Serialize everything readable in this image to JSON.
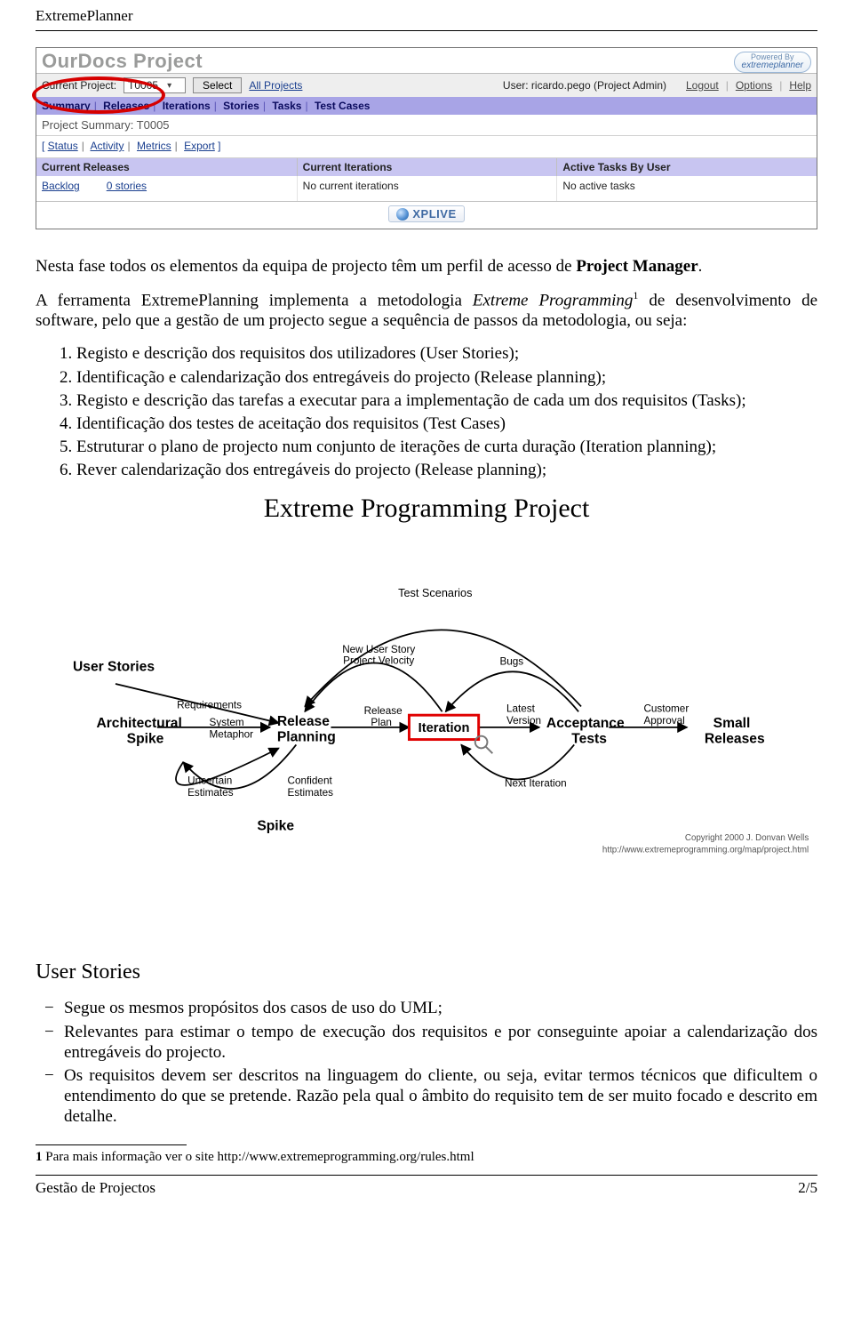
{
  "header": "ExtremePlanner",
  "app": {
    "title": "OurDocs Project",
    "powered_l1": "Powered By",
    "powered_l2": "extremeplanner",
    "current_project_lbl": "Current Project:",
    "current_project_val": "T0005",
    "select_btn": "Select",
    "all_projects": "All Projects",
    "user_lbl": "User: ricardo.pego (Project Admin)",
    "logout": "Logout",
    "options": "Options",
    "help": "Help",
    "tabs": [
      "Summary",
      "Releases",
      "Iterations",
      "Stories",
      "Tasks",
      "Test Cases"
    ],
    "psum": "Project Summary: T0005",
    "subtabs": [
      "Status",
      "Activity",
      "Metrics",
      "Export"
    ],
    "col1_h": "Current Releases",
    "col1_a": "Backlog",
    "col1_b": "0 stories",
    "col2_h": "Current Iterations",
    "col2_b": "No current iterations",
    "col3_h": "Active Tasks By User",
    "col3_b": "No active tasks",
    "xplive": "XPLIVE"
  },
  "p1a": "Nesta fase todos os elementos da equipa de projecto têm um perfil de acesso de ",
  "p1b": "Project Manager",
  "p1c": ".",
  "p2a": "A ferramenta ExtremePlanning implementa a metodologia ",
  "p2b": "Extreme Programming",
  "p2sup": "1",
  "p2c": " de desenvolvimento de software, pelo que a gestão de um projecto segue a sequência de passos da metodologia, ou seja:",
  "ol": [
    "Registo e descrição dos requisitos dos utilizadores (User Stories);",
    "Identificação e calendarização dos entregáveis do projecto (Release planning);",
    "Registo e descrição das tarefas a executar para a implementação de cada um dos requisitos (Tasks);",
    "Identificação dos testes de aceitação dos requisitos (Test Cases)",
    "Estruturar o plano de projecto num conjunto de iterações de curta duração (Iteration planning);",
    "Rever calendarização dos entregáveis do projecto (Release planning);"
  ],
  "diagram": {
    "title": "Extreme Programming Project",
    "test_scenarios": "Test Scenarios",
    "user_stories": "User Stories",
    "requirements": "Requirements",
    "new_story": "New User Story\nProject Velocity",
    "bugs": "Bugs",
    "arch_spike": "Architectural\nSpike",
    "system_metaphor": "System\nMetaphor",
    "release_planning": "Release\nPlanning",
    "release_plan": "Release\nPlan",
    "iteration": "Iteration",
    "latest_version": "Latest\nVersion",
    "acceptance_tests": "Acceptance\nTests",
    "customer_approval": "Customer\nApproval",
    "small_releases": "Small\nReleases",
    "uncertain": "Uncertain\nEstimates",
    "confident": "Confident\nEstimates",
    "spike": "Spike",
    "next_iteration": "Next Iteration",
    "copyright": "Copyright 2000 J. Donvan Wells",
    "url": "http://www.extremeprogramming.org/map/project.html"
  },
  "section_h": "User Stories",
  "ul": [
    "Segue os mesmos propósitos dos casos de uso do UML;",
    "Relevantes para estimar o tempo de execução dos requisitos e por conseguinte apoiar a calendarização dos entregáveis do projecto.",
    "Os requisitos devem ser descritos na linguagem do cliente, ou seja, evitar termos técnicos que dificultem o entendimento do que se pretende. Razão pela qual o âmbito do requisito tem de ser muito focado e descrito em detalhe."
  ],
  "footnote_pre": "1",
  "footnote": " Para mais informação ver o site http://www.extremeprogramming.org/rules.html",
  "footer_l": "Gestão de Projectos",
  "footer_r": "2/5"
}
